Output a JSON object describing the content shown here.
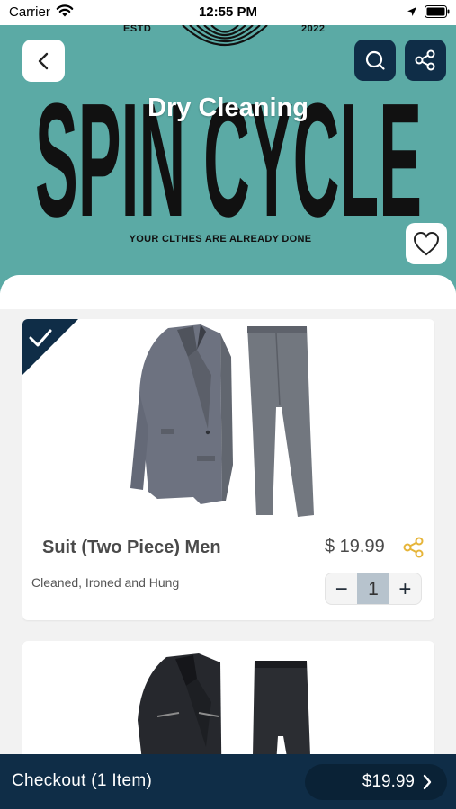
{
  "status_bar": {
    "carrier": "Carrier",
    "time": "12:55 PM"
  },
  "hero": {
    "estd": "ESTD",
    "year": "2022",
    "brand_name": "SPIN CYCLE",
    "tagline": "YOUR CLTHES ARE ALREADY DONE",
    "category_title": "Dry Cleaning",
    "background_color": "#5baaa5"
  },
  "toolbar": {
    "back_icon": "chevron-left-icon",
    "search_icon": "search-icon",
    "share_icon": "share-icon",
    "favorite_icon": "heart-icon"
  },
  "products": [
    {
      "name": "Suit (Two Piece) Men",
      "price": "$ 19.99",
      "description": "Cleaned, Ironed and Hung",
      "quantity": "1",
      "selected": true,
      "image": "grey-two-piece-suit-image"
    },
    {
      "name": "",
      "image": "black-two-piece-suit-image"
    }
  ],
  "stepper": {
    "minus": "−",
    "plus": "+"
  },
  "checkout": {
    "label": "Checkout (1 Item)",
    "total": "$19.99"
  },
  "colors": {
    "primary_dark": "#0f2d47",
    "teal": "#5baaa5",
    "share_accent": "#e6b53a"
  }
}
